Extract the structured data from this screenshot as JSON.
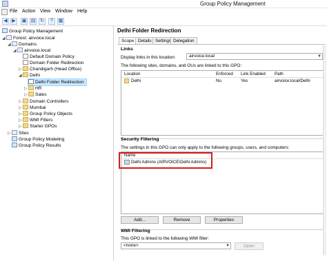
{
  "window": {
    "title": "Group Policy Management"
  },
  "menu": [
    "File",
    "Action",
    "View",
    "Window",
    "Help"
  ],
  "toolbar": {
    "buttons": [
      "back-icon",
      "forward-icon",
      "up-folder-icon",
      "properties-icon",
      "refresh-icon",
      "help-icon",
      "console-icon"
    ]
  },
  "tree": {
    "root": "Group Policy Management",
    "forest": "Forest: airvoice.local",
    "domains": "Domains",
    "domain": "airvoice.local",
    "items": [
      "Default Domain Policy",
      "Domain Folder Redirection",
      "Chandigarh (Head Office)",
      "Delhi",
      "Delhi Folder Redirection",
      "HR",
      "Sales",
      "Domain Controllers",
      "Mumbai",
      "Group Policy Objects",
      "WMI Filters",
      "Starter GPOs"
    ],
    "sites": "Sites",
    "modeling": "Group Policy Modeling",
    "results": "Group Policy Results"
  },
  "main": {
    "title": "Delhi Folder Redirection",
    "tabs": [
      "Scope",
      "Details",
      "Settings",
      "Delegation"
    ],
    "links": {
      "heading": "Links",
      "display_label": "Display links in this location:",
      "location_value": "airvoice.local",
      "desc": "The following sites, domains, and OUs are linked to this GPO:",
      "columns": [
        "Location",
        "Enforced",
        "Link Enabled",
        "Path"
      ],
      "rows": [
        {
          "location": "Delhi",
          "enforced": "No",
          "link_enabled": "Yes",
          "path": "airvoice.local/Delhi"
        }
      ]
    },
    "security": {
      "heading": "Security Filtering",
      "desc": "The settings in this GPO can only apply to the following groups, users, and computers:",
      "column": "Name",
      "rows": [
        "Delhi Admins (AIRVOICE\\Delhi Admins)"
      ],
      "buttons": {
        "add": "Add...",
        "remove": "Remove",
        "properties": "Properties"
      }
    },
    "wmi": {
      "heading": "WMI Filtering",
      "desc": "This GPO is linked to the following WMI filter:",
      "value": "<none>",
      "open": "Open"
    }
  },
  "colors": {
    "highlight": "#d61a1a",
    "selection": "#cce8ff"
  }
}
